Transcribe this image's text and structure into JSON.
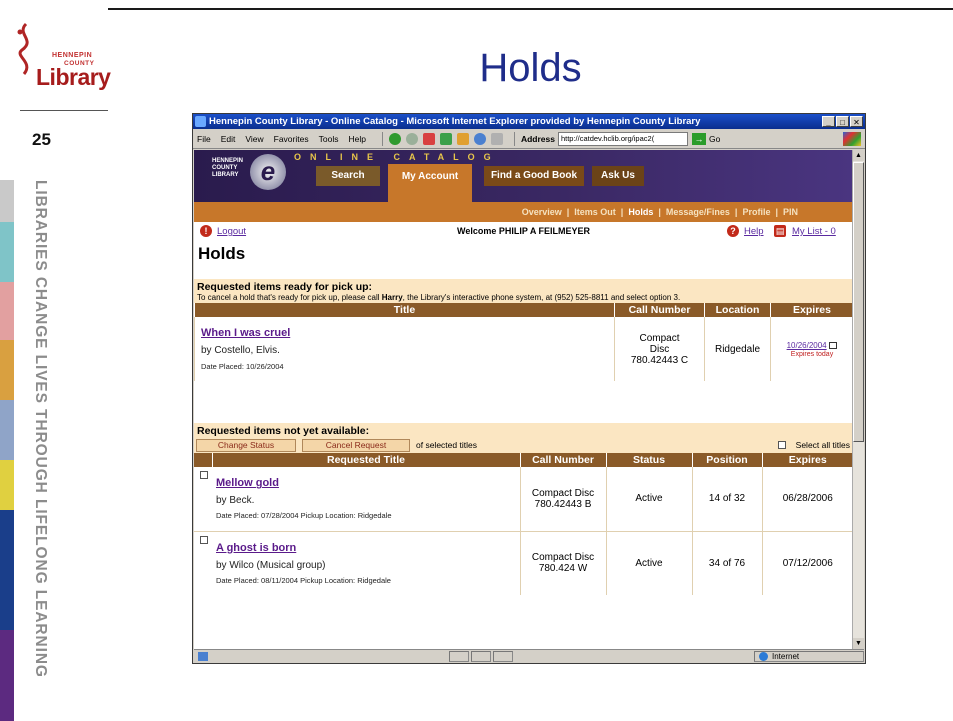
{
  "slide": {
    "title": "Holds",
    "number": "25",
    "side_text": "LIBRARIES CHANGE LIVES THROUGH LIFELONG LEARNING",
    "logo": {
      "line1": "HENNEPIN",
      "line2": "COUNTY",
      "line3": "Library"
    },
    "strip_colors": [
      "#c9c9c9",
      "#7fc4c8",
      "#e2a0a0",
      "#d9a040",
      "#8fa4c8",
      "#e0d040",
      "#1a3e8a",
      "#5c2a80"
    ]
  },
  "browser": {
    "window_title": "Hennepin County Library - Online Catalog - Microsoft Internet Explorer provided by Hennepin County Library",
    "menu": [
      "File",
      "Edit",
      "View",
      "Favorites",
      "Tools",
      "Help"
    ],
    "address_label": "Address",
    "address": "http://catdev.hclib.org/ipac2(",
    "go_label": "Go",
    "status_zone": "Internet"
  },
  "site": {
    "brand": {
      "line1": "HENNEPIN",
      "line2": "COUNTY",
      "line3": "LIBRARY"
    },
    "banner": "ONLINE CATALOG",
    "tabs": [
      "Search",
      "My Account",
      "Find a Good Book",
      "Ask Us"
    ],
    "subnav": [
      "Overview",
      "Items Out",
      "Holds",
      "Message/Fines",
      "Profile",
      "PIN"
    ],
    "logout": "Logout",
    "welcome": "Welcome PHILIP A FEILMEYER",
    "help": "Help",
    "mylist": "My List - 0",
    "page_heading": "Holds"
  },
  "ready": {
    "title": "Requested items ready for pick up:",
    "note_pre": "To cancel a hold that's ready for pick up, please call ",
    "note_name": "Harry",
    "note_post": ", the Library's interactive phone system, at (952) 525-8811 and select option 3.",
    "columns": [
      "Title",
      "Call Number",
      "Location",
      "Expires"
    ],
    "rows": [
      {
        "title": "When I was cruel",
        "by": "by Costello, Elvis.",
        "placed": "Date Placed: 10/26/2004",
        "call_line1": "Compact",
        "call_line2": "Disc",
        "call_line3": "780.42443 C",
        "location": "Ridgedale",
        "expires": "10/26/2004",
        "expires_note": "Expires today"
      }
    ]
  },
  "pending": {
    "title": "Requested items not yet available:",
    "change_status": "Change Status",
    "cancel_request": "Cancel Request",
    "of_selected": "of selected titles",
    "select_all": "Select all titles",
    "columns": [
      "Requested Title",
      "Call Number",
      "Status",
      "Position",
      "Expires"
    ],
    "rows": [
      {
        "title": "Mellow gold",
        "by": "by Beck.",
        "placed": "Date Placed: 07/28/2004  Pickup Location: Ridgedale",
        "call_line1": "Compact Disc",
        "call_line2": "780.42443 B",
        "status": "Active",
        "position": "14 of 32",
        "expires": "06/28/2006"
      },
      {
        "title": "A ghost is born",
        "by": "by Wilco (Musical group)",
        "placed": "Date Placed: 08/11/2004  Pickup Location: Ridgedale",
        "call_line1": "Compact Disc",
        "call_line2": "780.424 W",
        "status": "Active",
        "position": "34 of 76",
        "expires": "07/12/2006"
      }
    ]
  }
}
